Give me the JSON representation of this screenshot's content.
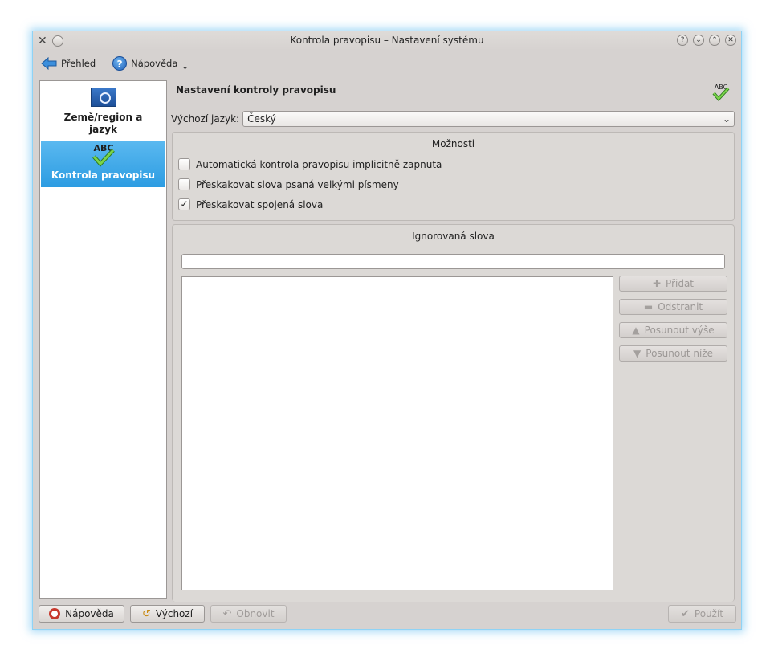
{
  "window": {
    "title": "Kontrola pravopisu – Nastavení systému"
  },
  "toolbar": {
    "overview_label": "Přehled",
    "help_label": "Nápověda"
  },
  "sidebar": {
    "items": [
      {
        "label": "Země/region a jazyk"
      },
      {
        "label": "Kontrola pravopisu"
      }
    ]
  },
  "main": {
    "title": "Nastavení kontroly pravopisu",
    "language_label": "Výchozí jazyk:",
    "language_value": "Český",
    "options_title": "Možnosti",
    "options": [
      {
        "label": "Automatická kontrola pravopisu implicitně zapnuta",
        "checked": false
      },
      {
        "label": "Přeskakovat slova psaná velkými písmeny",
        "checked": false
      },
      {
        "label": "Přeskakovat spojená slova",
        "checked": true
      }
    ],
    "ignored_title": "Ignorovaná slova",
    "ignored_input_value": "",
    "buttons": {
      "add": "Přidat",
      "remove": "Odstranit",
      "up": "Posunout výše",
      "down": "Posunout níže"
    }
  },
  "bottom": {
    "help": "Nápověda",
    "defaults": "Výchozí",
    "reset": "Obnovit",
    "apply": "Použít"
  }
}
